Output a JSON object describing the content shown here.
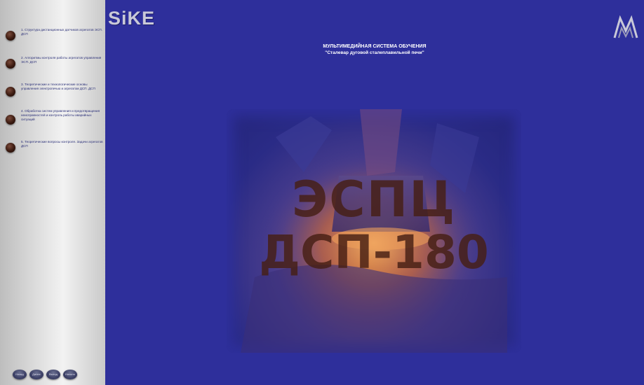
{
  "sidebar": {
    "items": [
      {
        "label": "1. Структура дистанционных датчиков агрегатов ЭСП. ДСП"
      },
      {
        "label": "2. Алгоритмы контроля работы агрегатов управления ЭСП. ДСП"
      },
      {
        "label": "3. Теоретические и технологические основы управления электропечью и агрегатом ДСП. ДСП"
      },
      {
        "label": "4. Обработка систем управления и предотвращения неисправностей и контроль работы аварийных ситуаций"
      },
      {
        "label": "5. Теоретические вопросы контроля. Задачи агрегатов ДСП"
      }
    ],
    "buttons": [
      {
        "label": "Назад"
      },
      {
        "label": "Далее"
      },
      {
        "label": "Выход"
      },
      {
        "label": "Начало"
      }
    ]
  },
  "header": {
    "logo_text": "SiKE",
    "title": "МУЛЬТИМЕДИЙНАЯ СИСТЕМА ОБУЧЕНИЯ",
    "subtitle": "\"Сталевар дуговой сталеплавильной печи\""
  },
  "hero": {
    "line1": "ЭСПЦ",
    "line2": "ДСП-180"
  },
  "colors": {
    "main_bg": "#2e2f9b",
    "sidebar_bg": "#e6e6e6",
    "menu_text": "#2a2f78",
    "header_text": "#ffffff"
  }
}
